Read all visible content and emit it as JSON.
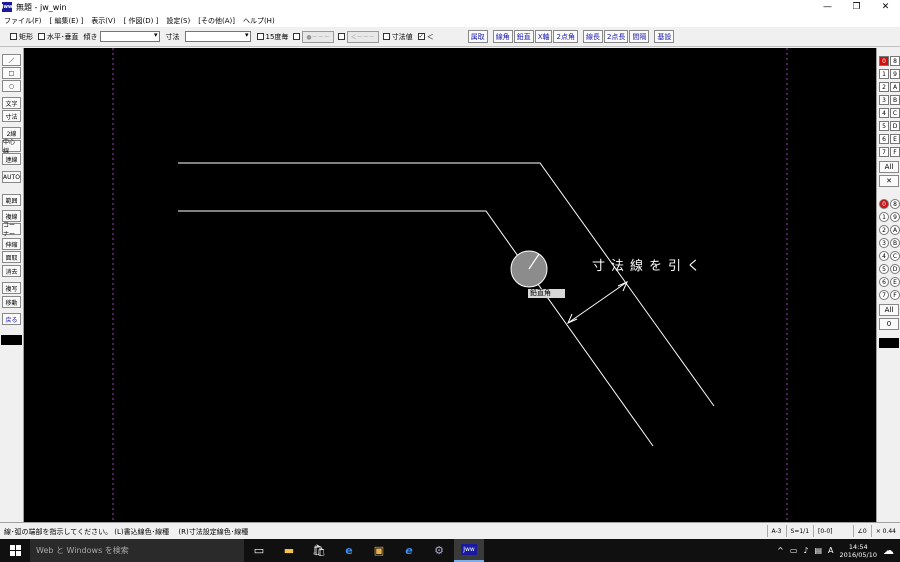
{
  "window": {
    "title": "無題 - jw_win",
    "app_icon": "Jww",
    "controls": [
      "—",
      "❐",
      "✕"
    ]
  },
  "menu": [
    "ファイル(F)",
    "[ 編集(E) ]",
    "表示(V)",
    "[ 作図(D) ]",
    "設定(S)",
    "[その他(A)]",
    "ヘルプ(H)"
  ],
  "toolbar": {
    "rect_label": "矩形",
    "hv_label": "水平･垂直",
    "tilt_label": "傾き",
    "dim_label": "寸法",
    "deg15_label": "15度毎",
    "dot_btn": "●－－－",
    "arrow_btn": "＜－－－",
    "dimval_label": "寸法値",
    "check_mark": "✓",
    "lt_label": "＜",
    "btn_tilt": "属取",
    "group1": [
      "線角",
      "鉛直",
      "X軸",
      "2点角"
    ],
    "group2": [
      "線長",
      "2点長",
      "間隔"
    ],
    "btn_base": "基設"
  },
  "left_palette": [
    "／",
    "□",
    "○",
    "文字",
    "寸法",
    "2線",
    "中心線",
    "連線",
    "AUTO",
    "範囲",
    "複線",
    "コーナー",
    "伸縮",
    "面取",
    "消去",
    "複写",
    "移動",
    "戻る"
  ],
  "right_palette": {
    "layer_rows": [
      [
        "0",
        "8"
      ],
      [
        "1",
        "9"
      ],
      [
        "2",
        "A"
      ],
      [
        "3",
        "B"
      ],
      [
        "4",
        "C"
      ],
      [
        "5",
        "D"
      ],
      [
        "6",
        "E"
      ],
      [
        "7",
        "F"
      ]
    ],
    "all_label": "All",
    "x_label": "✕",
    "group_rows": [
      [
        "0",
        "8"
      ],
      [
        "1",
        "9"
      ],
      [
        "2",
        "A"
      ],
      [
        "3",
        "B"
      ],
      [
        "4",
        "C"
      ],
      [
        "5",
        "D"
      ],
      [
        "6",
        "E"
      ],
      [
        "7",
        "F"
      ]
    ],
    "all2_label": "All",
    "zero_label": "0"
  },
  "canvas": {
    "dimension_text": "寸法線を引く",
    "angle_label": "鉛直角"
  },
  "status": {
    "message": "線･弧の端部を指示してください。 (L)書込線色･線種　 (R)寸法設定線色･線種",
    "paper": "A-3",
    "scale": "S=1/1",
    "layer": "[0-0]",
    "angle": "∠0",
    "zoom": "× 0.44"
  },
  "taskbar": {
    "search_placeholder": "Web と Windows を検索",
    "time": "14:54",
    "date": "2016/05/10",
    "ime": "A"
  }
}
